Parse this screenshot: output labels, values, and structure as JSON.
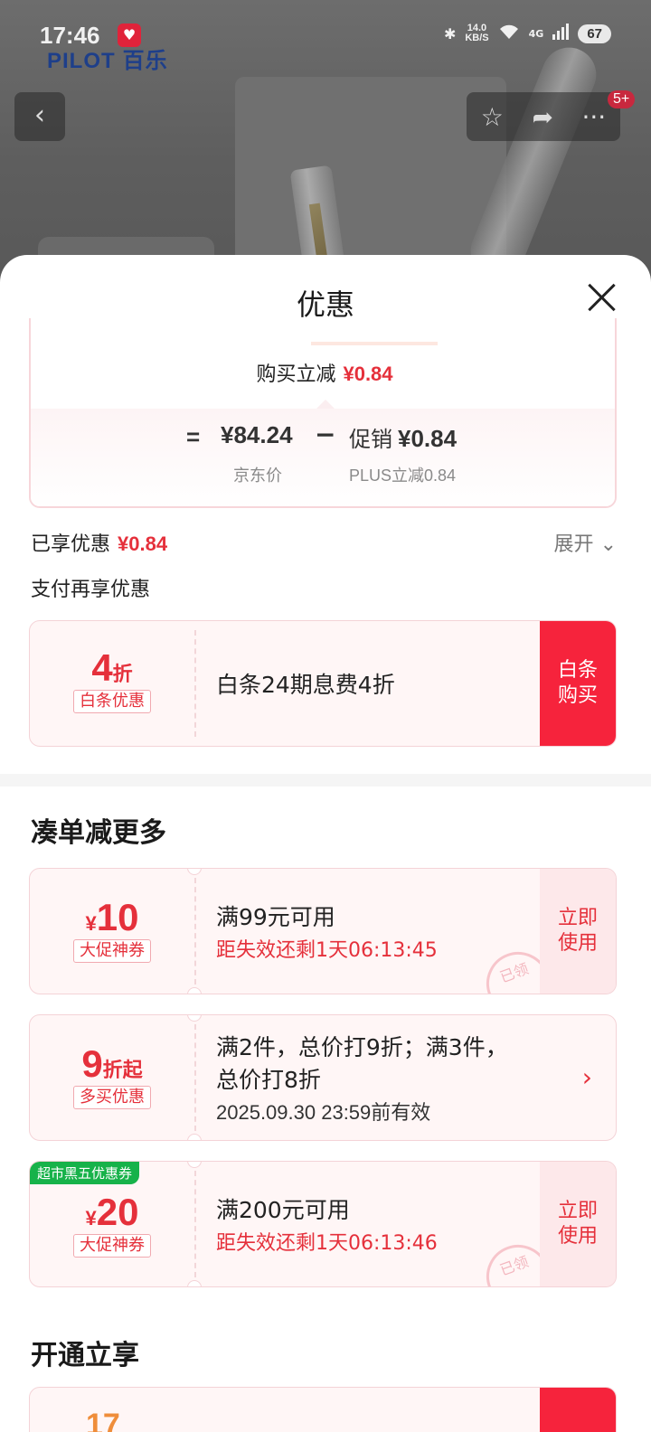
{
  "status_bar": {
    "time": "17:46",
    "speed_value": "14.0",
    "speed_unit": "KB/S",
    "network": "4G",
    "battery": "67"
  },
  "brand": {
    "name": "PILOT",
    "name_cn": "百乐"
  },
  "nav": {
    "badge": "5+"
  },
  "sheet": {
    "title": "优惠",
    "price_calc": {
      "buy_cut_label": "购买立减",
      "buy_cut_value": "¥0.84",
      "equals": "=",
      "jd_price": "¥84.24",
      "jd_price_label": "京东价",
      "minus": "−",
      "promo_label": "促销",
      "promo_value": "¥0.84",
      "promo_sub": "PLUS立减0.84"
    },
    "enjoyed_label": "已享优惠",
    "enjoyed_value": "¥0.84",
    "expand_label": "展开",
    "pay_more_label": "支付再享优惠",
    "baitiao": {
      "big": "4",
      "big_unit": "折",
      "tag": "白条优惠",
      "title": "白条24期息费4折",
      "action": "白条购买"
    },
    "section_more": "凑单减更多",
    "coupons": [
      {
        "currency": "¥",
        "amount": "10",
        "tag": "大促神券",
        "title": "满99元可用",
        "countdown": "距失效还剩1天06:13:45",
        "action": "立即使用",
        "stamp": "已领"
      },
      {
        "big": "9",
        "big_unit": "折起",
        "tag": "多买优惠",
        "title_line1": "满2件，总价打9折；满3件，",
        "title_line2": "总价打8折",
        "date": "2025.09.30 23:59前有效"
      },
      {
        "corner": "超市黑五优惠券",
        "currency": "¥",
        "amount": "20",
        "tag": "大促神券",
        "title": "满200元可用",
        "countdown": "距失效还剩1天06:13:46",
        "action": "立即使用",
        "stamp": "已领"
      }
    ],
    "section_open": "开通立享"
  }
}
